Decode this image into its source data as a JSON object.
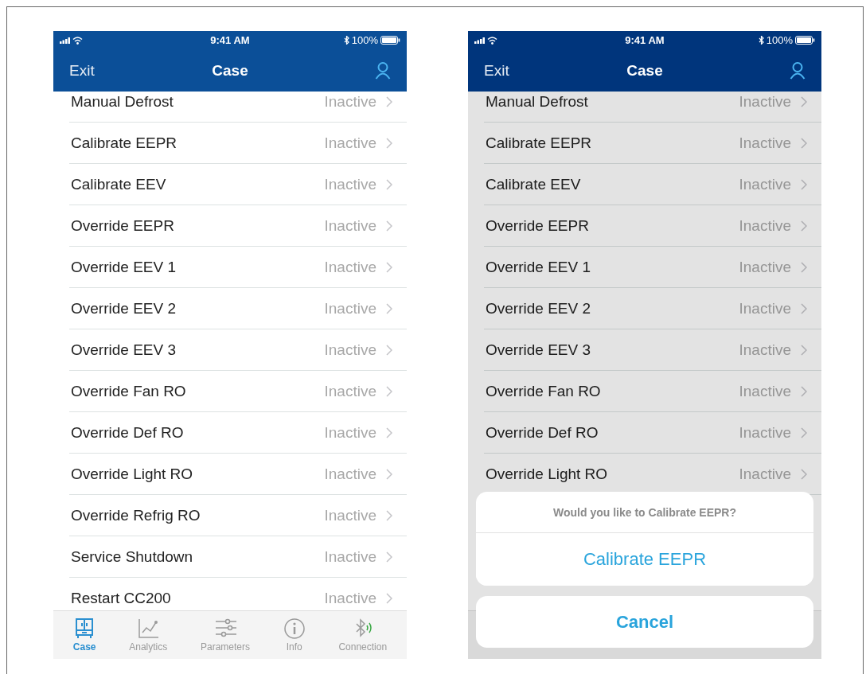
{
  "screens": [
    {
      "dimmed": false,
      "status_bar": {
        "time": "9:41 AM",
        "battery": "100%"
      },
      "nav": {
        "left": "Exit",
        "title": "Case"
      },
      "rows": [
        {
          "label": "Manual Defrost",
          "value": "Inactive"
        },
        {
          "label": "Calibrate EEPR",
          "value": "Inactive"
        },
        {
          "label": "Calibrate EEV",
          "value": "Inactive"
        },
        {
          "label": "Override EEPR",
          "value": "Inactive"
        },
        {
          "label": "Override EEV 1",
          "value": "Inactive"
        },
        {
          "label": "Override EEV 2",
          "value": "Inactive"
        },
        {
          "label": "Override EEV 3",
          "value": "Inactive"
        },
        {
          "label": "Override Fan RO",
          "value": "Inactive"
        },
        {
          "label": "Override Def RO",
          "value": "Inactive"
        },
        {
          "label": "Override Light RO",
          "value": "Inactive"
        },
        {
          "label": "Override Refrig RO",
          "value": "Inactive"
        },
        {
          "label": "Service Shutdown",
          "value": "Inactive"
        },
        {
          "label": "Restart CC200",
          "value": "Inactive"
        }
      ],
      "tab_bar": [
        {
          "kind": "case",
          "label": "Case",
          "selected": true
        },
        {
          "kind": "analytics",
          "label": "Analytics",
          "selected": false
        },
        {
          "kind": "parameters",
          "label": "Parameters",
          "selected": false
        },
        {
          "kind": "info",
          "label": "Info",
          "selected": false
        },
        {
          "kind": "connection",
          "label": "Connection",
          "selected": false
        }
      ]
    },
    {
      "dimmed": true,
      "status_bar": {
        "time": "9:41 AM",
        "battery": "100%"
      },
      "nav": {
        "left": "Exit",
        "title": "Case"
      },
      "rows": [
        {
          "label": "Manual Defrost",
          "value": "Inactive"
        },
        {
          "label": "Calibrate EEPR",
          "value": "Inactive"
        },
        {
          "label": "Calibrate EEV",
          "value": "Inactive"
        },
        {
          "label": "Override EEPR",
          "value": "Inactive"
        },
        {
          "label": "Override EEV 1",
          "value": "Inactive"
        },
        {
          "label": "Override EEV 2",
          "value": "Inactive"
        },
        {
          "label": "Override EEV 3",
          "value": "Inactive"
        },
        {
          "label": "Override Fan RO",
          "value": "Inactive"
        },
        {
          "label": "Override Def RO",
          "value": "Inactive"
        },
        {
          "label": "Override Light RO",
          "value": "Inactive"
        }
      ],
      "action_sheet": {
        "message": "Would you like to Calibrate EEPR?",
        "action": "Calibrate EEPR",
        "cancel": "Cancel"
      }
    }
  ]
}
